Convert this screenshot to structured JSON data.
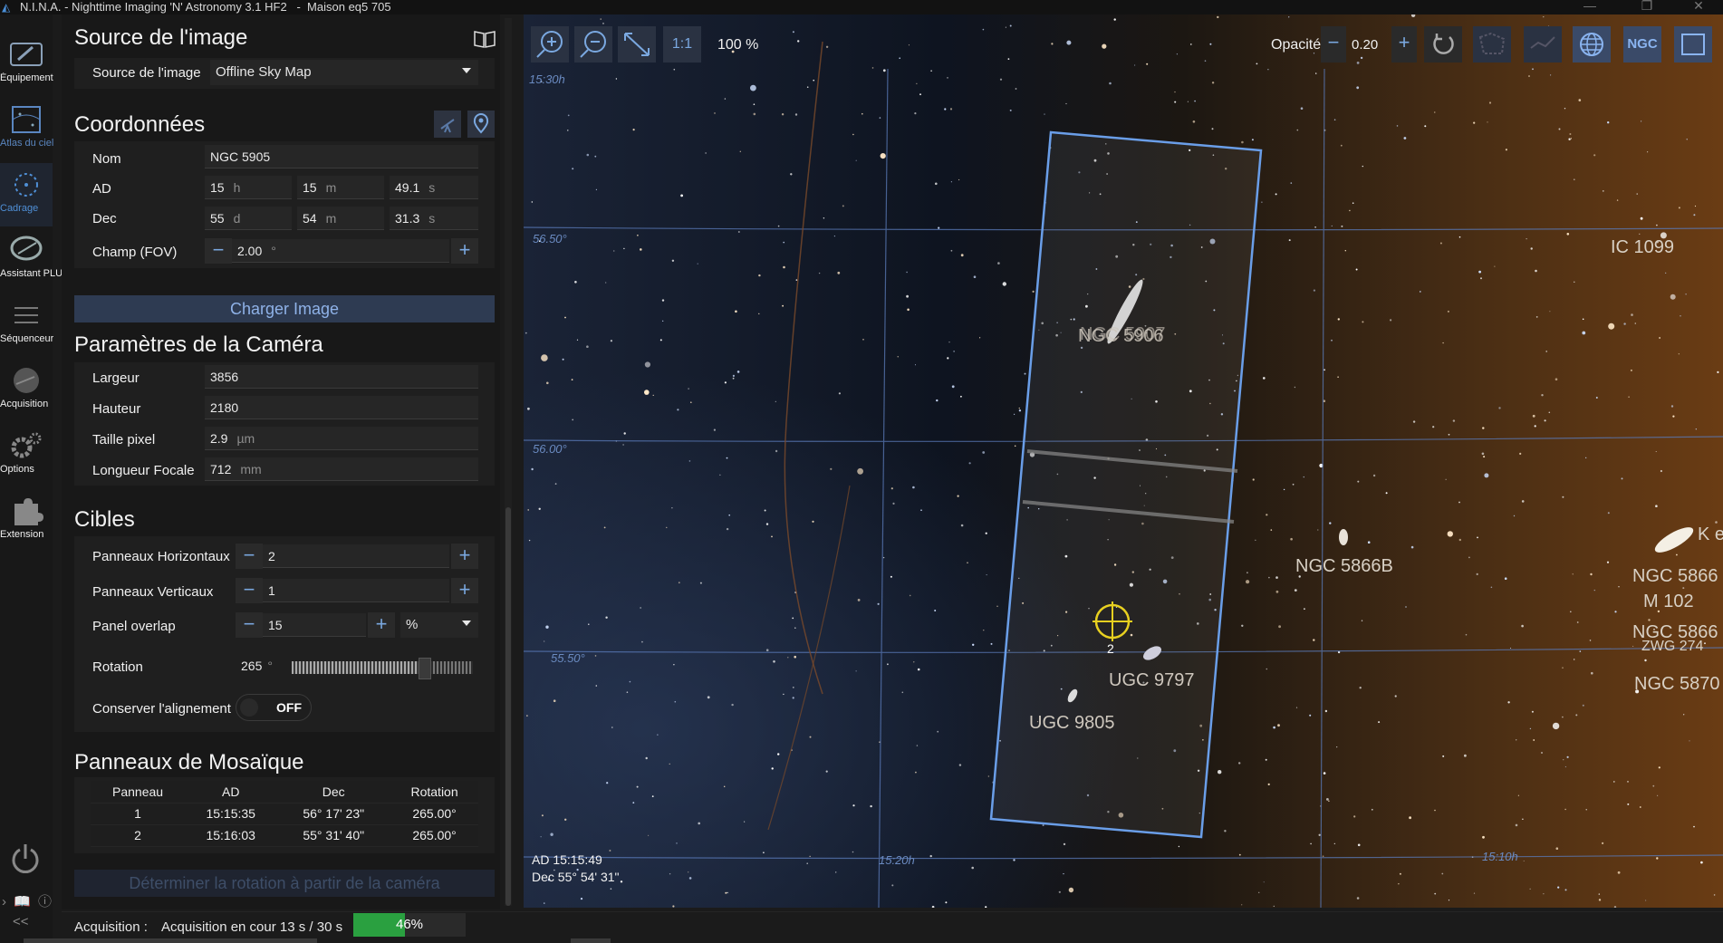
{
  "window": {
    "title": "N.I.N.A. - Nighttime Imaging 'N' Astronomy 3.1 HF2   -  Maison eq5 705",
    "controls": [
      "—",
      "❐",
      "✕"
    ]
  },
  "nav": {
    "items": [
      {
        "label": "Équipement",
        "icon": "camera-icon"
      },
      {
        "label": "Atlas du ciel",
        "icon": "sky-atlas-icon"
      },
      {
        "label": "Cadrage",
        "icon": "framing-icon",
        "active": true
      },
      {
        "label": "Assistant PLU",
        "icon": "flat-wizard-icon"
      },
      {
        "label": "Séquenceur",
        "icon": "sequencer-icon"
      },
      {
        "label": "Acquisition",
        "icon": "imaging-icon"
      },
      {
        "label": "Options",
        "icon": "gear-icon"
      },
      {
        "label": "Extension",
        "icon": "puzzle-icon"
      }
    ],
    "collapse_label": "<<"
  },
  "image_source": {
    "title": "Source de l'image",
    "label": "Source de l'image",
    "value": "Offline Sky Map"
  },
  "coordinates": {
    "title": "Coordonnées",
    "name_label": "Nom",
    "name_value": "NGC 5905",
    "ra_label": "AD",
    "ra_h": "15",
    "ra_h_unit": "h",
    "ra_m": "15",
    "ra_m_unit": "m",
    "ra_s": "49.1",
    "ra_s_unit": "s",
    "dec_label": "Dec",
    "dec_d": "55",
    "dec_d_unit": "d",
    "dec_m": "54",
    "dec_m_unit": "m",
    "dec_s": "31.3",
    "dec_s_unit": "s",
    "fov_label": "Champ (FOV)",
    "fov_value": "2.00",
    "fov_unit": "°",
    "load_button": "Charger Image"
  },
  "camera": {
    "title": "Paramètres de la Caméra",
    "width_label": "Largeur",
    "width_value": "3856",
    "height_label": "Hauteur",
    "height_value": "2180",
    "pixel_label": "Taille pixel",
    "pixel_value": "2.9",
    "pixel_unit": "µm",
    "focal_label": "Longueur Focale",
    "focal_value": "712",
    "focal_unit": "mm"
  },
  "targets": {
    "title": "Cibles",
    "hpanels_label": "Panneaux Horizontaux",
    "hpanels_value": "2",
    "vpanels_label": "Panneaux Verticaux",
    "vpanels_value": "1",
    "overlap_label": "Panel overlap",
    "overlap_value": "15",
    "overlap_unit": "%",
    "rotation_label": "Rotation",
    "rotation_value": "265",
    "rotation_unit": "°",
    "rotation_fraction": 0.736,
    "keep_align_label": "Conserver l'alignement",
    "keep_align_value": "OFF"
  },
  "mosaic": {
    "title": "Panneaux de Mosaïque",
    "headers": [
      "Panneau",
      "AD",
      "Dec",
      "Rotation"
    ],
    "rows": [
      [
        "1",
        "15:15:35",
        "56° 17' 23\"",
        "265.00°"
      ],
      [
        "2",
        "15:16:03",
        "55° 31' 40\"",
        "265.00°"
      ]
    ],
    "rotation_button": "Déterminer la rotation à partir de la caméra"
  },
  "status": {
    "label": "Acquisition :",
    "text": "Acquisition en cour 13 s / 30 s",
    "progress_percent": 46,
    "progress_text": "46%"
  },
  "sky_toolbar": {
    "zoom_level": "100 %",
    "one_to_one": "1:1",
    "opacity_label": "Opacité",
    "opacity_value": "0.20",
    "ngc_label": "NGC"
  },
  "sky_labels": {
    "dec_grid": [
      "56.50°",
      "56.00°",
      "55.50°"
    ],
    "ra_grid": [
      "15:30h",
      "15:20h",
      "15:10h"
    ],
    "objects": [
      "NGC 5906",
      "NGC 5907",
      "IC 1099",
      "NGC 5866B",
      "UGC 9797",
      "UGC 9805",
      "NGC 5866",
      "M 102",
      "NGC 5866",
      "NGC 5870",
      "ZWG 274"
    ],
    "obj_k": "K e",
    "obj_ngc5866_a": "NGC 5866",
    "obj_m102": "M 102",
    "marker_label": "2",
    "readout_ra": "AD  15:15:49",
    "readout_dec": "Dec 55° 54' 31\""
  },
  "colors": {
    "accent": "#4f8fd6",
    "progress": "#2aa040",
    "frame": "#6a9ee8",
    "crosshair": "#e8d020"
  }
}
